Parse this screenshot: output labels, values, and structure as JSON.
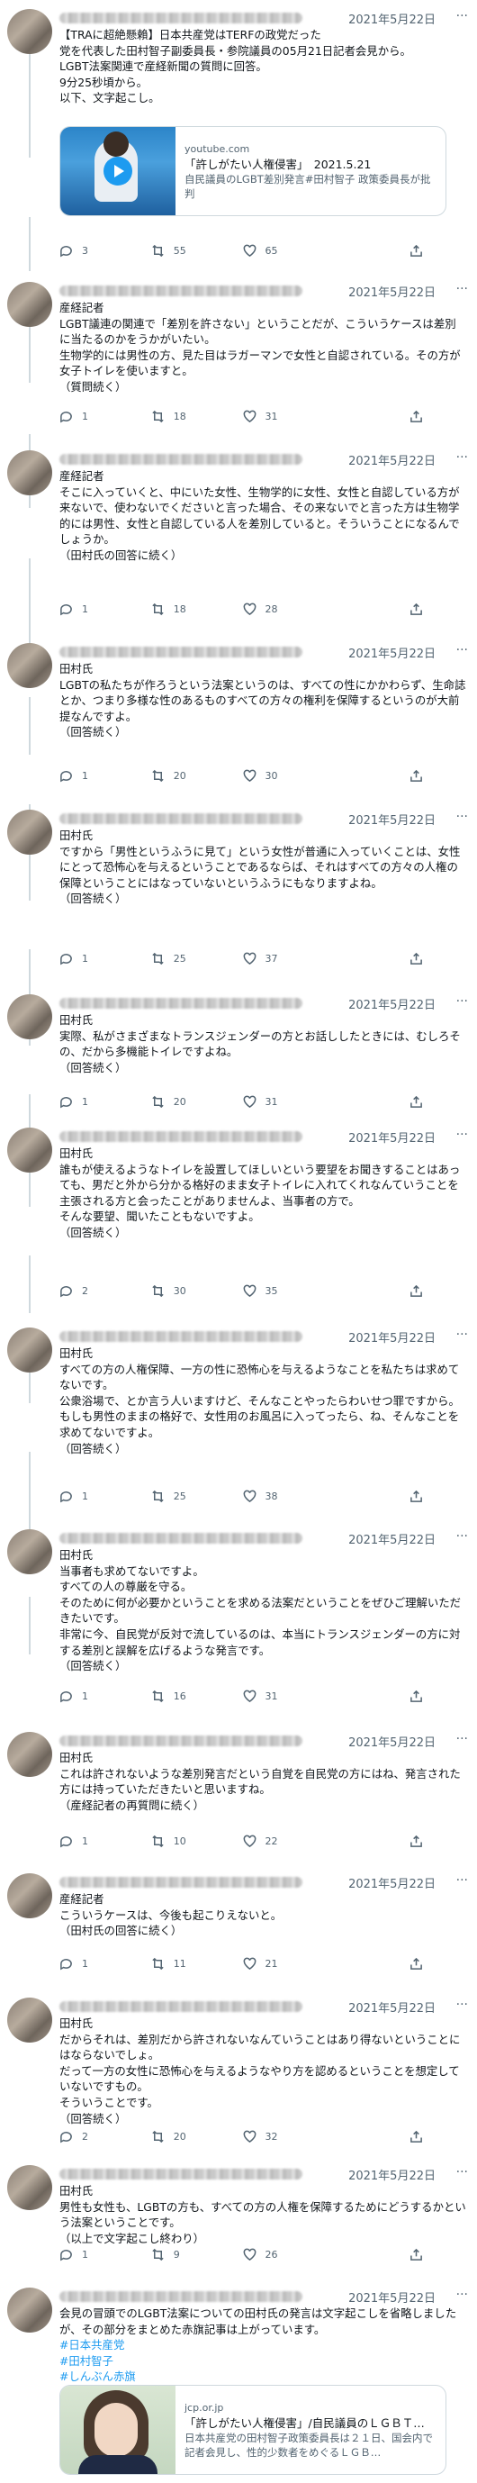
{
  "tweets": [
    {
      "date": "2021年5月22日",
      "text": "【TRAに超絶懸賴】日本共産党はTERFの政党だった\n党を代表した田村智子副委員長・参院議員の05月21日記者会見から。\nLGBT法案関連で産経新聞の質問に回答。\n9分25秒頃から。\n以下、文字起こし。",
      "reply": "3",
      "retweet": "55",
      "like": "65"
    },
    {
      "date": "2021年5月22日",
      "text": "産経記者\nLGBT議連の関連で「差別を許さない」ということだが、こういうケースは差別に当たるのかをうかがいたい。\n生物学的には男性の方、見た目はラガーマンで女性と自認されている。その方が女子トイレを使いますと。\n（質問続く）",
      "reply": "1",
      "retweet": "18",
      "like": "31"
    },
    {
      "date": "2021年5月22日",
      "text": "産経記者\nそこに入っていくと、中にいた女性、生物学的に女性、女性と自認している方が来ないで、使わないでくださいと言った場合、その来ないでと言った方は生物学的には男性、女性と自認している人を差別していると。そういうことになるんでしょうか。\n（田村氏の回答に続く）",
      "reply": "1",
      "retweet": "18",
      "like": "28"
    },
    {
      "date": "2021年5月22日",
      "text": "田村氏\nLGBTの私たちが作ろうという法案というのは、すべての性にかかわらず、生命誌とか、つまり多様な性のあるものすべての方々の権利を保障するというのが大前提なんですよ。\n（回答続く）",
      "reply": "1",
      "retweet": "20",
      "like": "30"
    },
    {
      "date": "2021年5月22日",
      "text": "田村氏\nですから「男性というふうに見て」という女性が普通に入っていくことは、女性にとって恐怖心を与えるということであるならば、それはすべての方々の人権の保障ということにはなっていないというふうにもなりますよね。\n（回答続く）",
      "reply": "1",
      "retweet": "25",
      "like": "37"
    },
    {
      "date": "2021年5月22日",
      "text": "田村氏\n実際、私がさまざまなトランスジェンダーの方とお話ししたときには、むしろその、だから多機能トイレですよね。\n（回答続く）",
      "reply": "1",
      "retweet": "20",
      "like": "31"
    },
    {
      "date": "2021年5月22日",
      "text": "田村氏\n誰もが使えるようなトイレを設置してほしいという要望をお聞きすることはあっても、男だと外から分かる格好のまま女子トイレに入れてくれなんていうことを主張される方と会ったことがありませんよ、当事者の方で。\nそんな要望、聞いたこともないですよ。\n（回答続く）",
      "reply": "2",
      "retweet": "30",
      "like": "35"
    },
    {
      "date": "2021年5月22日",
      "text": "田村氏\nすべての方の人権保障、一方の性に恐怖心を与えるようなことを私たちは求めてないです。\n公衆浴場で、とか言う人いますけど、そんなことやったらわいせつ罪ですから。\nもしも男性のままの格好で、女性用のお風呂に入ってったら、ね、そんなことを求めてないですよ。\n（回答続く）",
      "reply": "1",
      "retweet": "25",
      "like": "38"
    },
    {
      "date": "2021年5月22日",
      "text": "田村氏\n当事者も求めてないですよ。\nすべての人の尊厳を守る。\nそのために何が必要かということを求める法案だということをぜひご理解いただきたいです。\n非常に今、自民党が反対で流しているのは、本当にトランスジェンダーの方に対する差別と誤解を広げるような発言です。\n（回答続く）",
      "reply": "1",
      "retweet": "16",
      "like": "31"
    },
    {
      "date": "2021年5月22日",
      "text": "田村氏\nこれは許されないような差別発言だという自覚を自民党の方にはね、発言された方には持っていただきたいと思いますね。\n（産経記者の再質問に続く）",
      "reply": "1",
      "retweet": "10",
      "like": "22"
    },
    {
      "date": "2021年5月22日",
      "text": "産経記者\nこういうケースは、今後も起こりえないと。\n（田村氏の回答に続く）",
      "reply": "1",
      "retweet": "11",
      "like": "21"
    },
    {
      "date": "2021年5月22日",
      "text": "田村氏\nだからそれは、差別だから許されないなんていうことはあり得ないということにはならないでしょ。\nだって一方の女性に恐怖心を与えるようなやり方を認めるということを想定していないですもの。\nそういうことです。\n（回答続く）",
      "reply": "2",
      "retweet": "20",
      "like": "32"
    },
    {
      "date": "2021年5月22日",
      "text": "田村氏\n男性も女性も、LGBTの方も、すべての方の人権を保障するためにどうするかという法案ということです。\n（以上で文字起こし終わり）",
      "reply": "1",
      "retweet": "9",
      "like": "26"
    },
    {
      "date": "2021年5月22日",
      "text": "会見の冒頭でのLGBT法案についての田村氏の発言は文字起こしを省略しましたが、その部分をまとめた赤旗記事は上がっています。",
      "hashtags": [
        "#日本共産党",
        "#田村智子",
        "#しんぶん赤旗"
      ],
      "reply": "",
      "retweet": "",
      "like": ""
    }
  ],
  "cards": [
    {
      "domain": "youtube.com",
      "title": "「許しがたい人権侵害」　2021.5.21",
      "desc": "自民議員のLGBT差別発言#田村智子 政策委員長が批判"
    },
    {
      "domain": "jcp.or.jp",
      "title": "「許しがたい人権侵害」/自民議員のＬＧＢＴ…",
      "desc": "日本共産党の田村智子政策委員長は２１日、国会内で記者会見し、性的少数者をめぐるＬＧＢ…"
    }
  ],
  "icons": {
    "reply": "reply-icon",
    "retweet": "retweet-icon",
    "like": "like-icon",
    "share": "share-icon",
    "more": "more-icon",
    "play": "play-icon"
  },
  "colors": {
    "link": "#1d9bf0",
    "muted": "#536471",
    "border": "#cfd9de"
  }
}
